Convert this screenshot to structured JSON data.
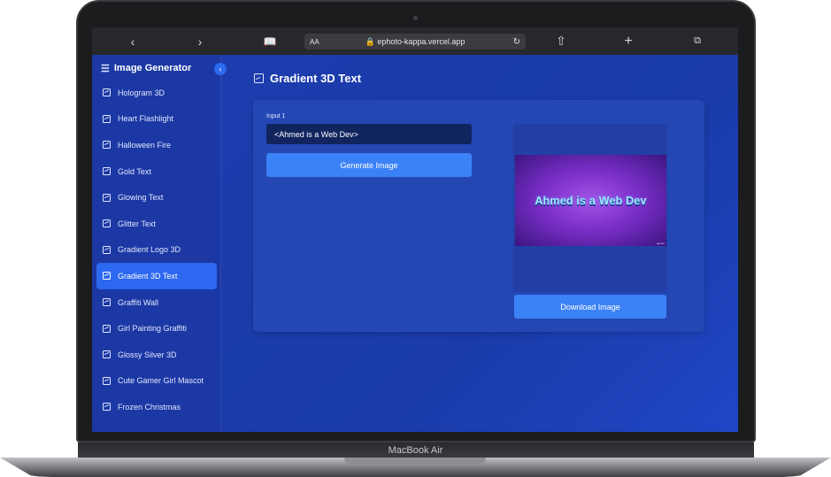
{
  "device": {
    "label": "MacBook Air"
  },
  "browser": {
    "back_icon": "chevron-left",
    "forward_icon": "chevron-right",
    "aa_label": "AA",
    "url": "ephoto-kappa.vercel.app",
    "lock_icon": "lock",
    "reload_icon": "reload"
  },
  "sidebar": {
    "title": "Image Generator",
    "items": [
      {
        "label": "Hologram 3D"
      },
      {
        "label": "Heart Flashlight"
      },
      {
        "label": "Halloween Fire"
      },
      {
        "label": "Gold Text"
      },
      {
        "label": "Glowing Text"
      },
      {
        "label": "Glitter Text"
      },
      {
        "label": "Gradient Logo 3D"
      },
      {
        "label": "Gradient 3D Text",
        "active": true
      },
      {
        "label": "Graffiti Wall"
      },
      {
        "label": "Girl Painting Graffiti"
      },
      {
        "label": "Glossy Silver 3D"
      },
      {
        "label": "Cute Gamer Girl Mascot"
      },
      {
        "label": "Frozen Christmas"
      }
    ]
  },
  "main": {
    "title": "Gradient 3D Text",
    "input_label": "Input 1",
    "input_value": "<Ahmed is a Web Dev>",
    "generate_label": "Generate Image",
    "preview_text": "Ahmed is a Web Dev",
    "download_label": "Download Image"
  },
  "colors": {
    "accent": "#3b82f6",
    "sidebar_bg": "#1c38a4",
    "main_bg": "#1d3dae"
  }
}
